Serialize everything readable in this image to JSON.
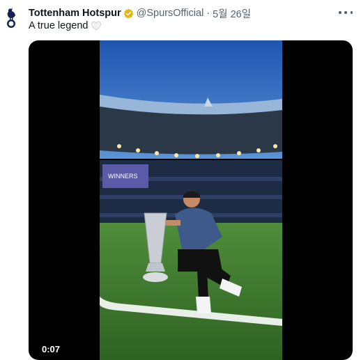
{
  "tweet": {
    "author_name": "Tottenham Hotspur",
    "verified_badge_icon": "verified-badge-icon",
    "handle": "@SpursOfficial",
    "separator": "·",
    "date": "5월 26일",
    "text": "A true legend",
    "emoji_icon": "white-heart-icon",
    "more_icon": "more-options-icon"
  },
  "media": {
    "type": "video",
    "timestamp": "0:07",
    "banner_text": "WINNERS",
    "colors": {
      "sky": "#2a63b8",
      "pitch": "#3b7a2c",
      "shirt": "#3e5a8a"
    }
  },
  "colors": {
    "text_primary": "#0f1419",
    "text_secondary": "#536471",
    "badge_gold": "#e2b719"
  }
}
